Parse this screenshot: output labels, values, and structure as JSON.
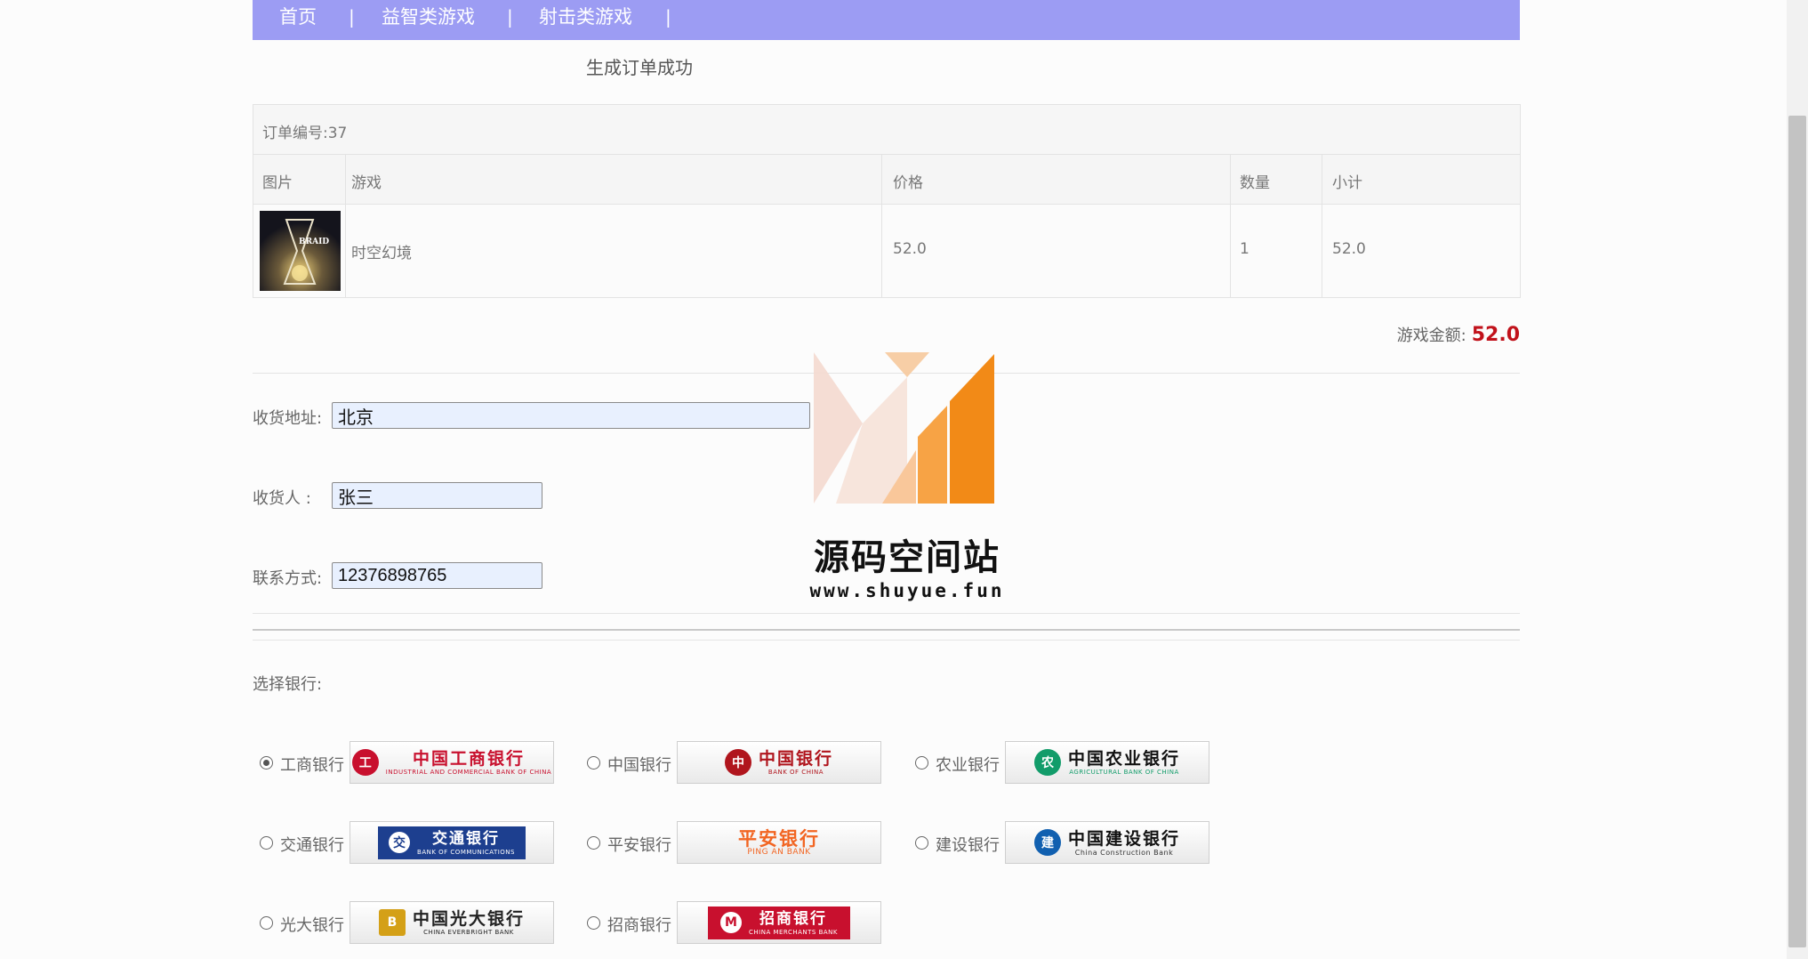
{
  "nav": {
    "items": [
      "首页",
      "益智类游戏",
      "射击类游戏"
    ],
    "separator": "|"
  },
  "status_message": "生成订单成功",
  "order": {
    "number_label": "订单编号:37",
    "columns": [
      "图片",
      "游戏",
      "价格",
      "数量",
      "小计"
    ],
    "items": [
      {
        "image_label": "BRAID",
        "name": "时空幻境",
        "price": "52.0",
        "quantity": "1",
        "subtotal": "52.0"
      }
    ]
  },
  "total": {
    "label": "游戏金额:",
    "value": "52.0"
  },
  "form": {
    "address_label": "收货地址:",
    "address_value": "北京",
    "receiver_label": "收货人 :",
    "receiver_value": "张三",
    "phone_label": "联系方式:",
    "phone_value": "12376898765"
  },
  "bank": {
    "title": "选择银行:",
    "selected": "工商银行",
    "options": [
      {
        "name": "工商银行",
        "logo_cn": "中国工商银行",
        "logo_en": "INDUSTRIAL AND COMMERCIAL BANK OF CHINA",
        "color": "#c8102e",
        "mark": "工"
      },
      {
        "name": "中国银行",
        "logo_cn": "中国银行",
        "logo_en": "BANK OF CHINA",
        "color": "#b0151d",
        "mark": "中"
      },
      {
        "name": "农业银行",
        "logo_cn": "中国农业银行",
        "logo_en": "AGRICULTURAL BANK OF CHINA",
        "color": "#129c6a",
        "mark": "农"
      },
      {
        "name": "交通银行",
        "logo_cn": "交通银行",
        "logo_en": "BANK OF COMMUNICATIONS",
        "color": "#1d3f8f",
        "mark": "交"
      },
      {
        "name": "平安银行",
        "logo_cn": "平安银行",
        "logo_en": "PING AN BANK",
        "color": "#f26522",
        "mark": ""
      },
      {
        "name": "建设银行",
        "logo_cn": "中国建设银行",
        "logo_en": "China Construction Bank",
        "color": "#1160b0",
        "mark": "建"
      },
      {
        "name": "光大银行",
        "logo_cn": "中国光大银行",
        "logo_en": "CHINA EVERBRIGHT BANK",
        "color": "#d4a017",
        "mark": "B"
      },
      {
        "name": "招商银行",
        "logo_cn": "招商银行",
        "logo_en": "CHINA MERCHANTS BANK",
        "color": "#c8102e",
        "mark": "M"
      }
    ]
  },
  "watermark": {
    "title": "源码空间站",
    "url": "www.shuyue.fun"
  },
  "colors": {
    "nav_bg": "#9c9cf3",
    "total_value": "#c1121b"
  }
}
